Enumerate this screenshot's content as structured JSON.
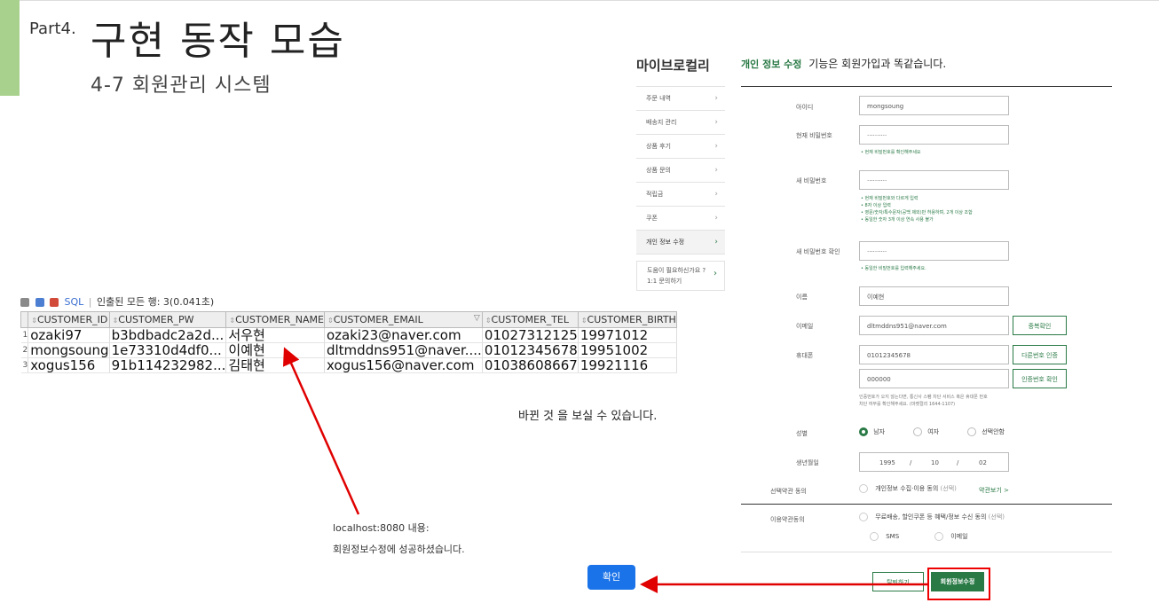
{
  "slide": {
    "part": "Part4.",
    "title": "구현 동작 모습",
    "subtitle": "4-7 회원관리 시스템"
  },
  "sidebar": {
    "title": "마이브로컬리",
    "items": [
      {
        "label": "주문 내역"
      },
      {
        "label": "배송지 관리"
      },
      {
        "label": "상품 후기"
      },
      {
        "label": "상품 문의"
      },
      {
        "label": "적립금"
      },
      {
        "label": "쿠폰"
      },
      {
        "label": "개인 정보 수정"
      }
    ],
    "help": {
      "line1": "도움이 필요하신가요 ?",
      "line2": "1:1 문의하기"
    }
  },
  "form": {
    "heading_highlight": "개인 정보 수정",
    "heading_rest": "기능은 회원가입과 똑같습니다.",
    "labels": {
      "id": "아이디",
      "current_pw": "현재 비밀번호",
      "new_pw": "새 비밀번호",
      "new_pw_confirm": "새 비밀번호 확인",
      "name": "이름",
      "email": "이메일",
      "phone": "휴대폰",
      "gender": "성별",
      "birth": "생년월일",
      "optional_terms": "선택약관 동의",
      "marketing_terms": "이용약관동의"
    },
    "values": {
      "id": "mongsoung",
      "current_pw": "··········",
      "new_pw": "··········",
      "new_pw_confirm": "··········",
      "name": "이예현",
      "email": "dltmddns951@naver.com",
      "phone": "01012345678",
      "auth_code": "000000",
      "birth_year": "1995",
      "birth_month": "10",
      "birth_day": "02",
      "birth_sep": "/"
    },
    "hints": {
      "current_pw": "• 현재 비밀번호를 확인해주세요",
      "new_pw_1": "• 현재 비밀번호와 다르게 입력",
      "new_pw_2": "• 8자 이상 입력",
      "new_pw_3": "• 영문/숫자/특수문자(공백 제외)만 허용하며, 2개 이상 조합",
      "new_pw_4": "• 동일한 숫자 3개 이상 연속 사용 불가",
      "new_pw_confirm": "• 동일한 비밀번호를 입력해주세요.",
      "auth_1": "인증번호가 오지 않는다면, 통신사 스팸 차단 서비스 혹은 휴대폰 번호",
      "auth_2": "차단 여부를 확인해주세요. (마켓컬리 1644-1107)"
    },
    "buttons": {
      "email_check": "중복확인",
      "phone_auth": "다른번호 인증",
      "auth_confirm": "인증번호 확인",
      "quit": "탈퇴하기",
      "save": "회원정보수정"
    },
    "gender": {
      "male": "남자",
      "female": "여자",
      "none": "선택안함"
    },
    "terms": {
      "privacy": "개인정보 수집·이용 동의",
      "privacy_tag": "(선택)",
      "view": "약관보기 >",
      "marketing": "무료배송, 할인쿠폰 등 혜택/정보 수신 동의",
      "marketing_tag": "(선택)",
      "sms": "SMS",
      "email": "이메일"
    }
  },
  "db": {
    "toolbar_sql": "SQL",
    "toolbar_sep": "|",
    "toolbar_status": "인출된 모든 행: 3(0.041초)",
    "columns": [
      "CUSTOMER_ID",
      "CUSTOMER_PW",
      "CUSTOMER_NAME",
      "CUSTOMER_EMAIL",
      "CUSTOMER_TEL",
      "CUSTOMER_BIRTH"
    ],
    "rows": [
      {
        "n": "1",
        "id": "ozaki97",
        "pw": "b3bdbadc2a2d...",
        "name": "서우현",
        "email": "ozaki23@naver.com",
        "tel": "01027312125",
        "birth": "19971012"
      },
      {
        "n": "2",
        "id": "mongsoung",
        "pw": "1e73310d4df0...",
        "name": "이예현",
        "email": "dltmddns951@naver....",
        "tel": "01012345678",
        "birth": "19951002"
      },
      {
        "n": "3",
        "id": "xogus156",
        "pw": "91b114232982...",
        "name": "김태현",
        "email": "xogus156@naver.com",
        "tel": "01038608667",
        "birth": "19921116"
      }
    ]
  },
  "annotation": {
    "note": "바뀐 것 을 보실 수 있습니다."
  },
  "alert": {
    "host": "localhost:8080 내용:",
    "message": "회원정보수정에 성공하셨습니다.",
    "ok": "확인"
  },
  "colors": {
    "brand_green": "#2a7a46",
    "arrow_red": "#e00000",
    "slide_green": "#a9d18e",
    "alert_blue": "#1a73e8"
  }
}
